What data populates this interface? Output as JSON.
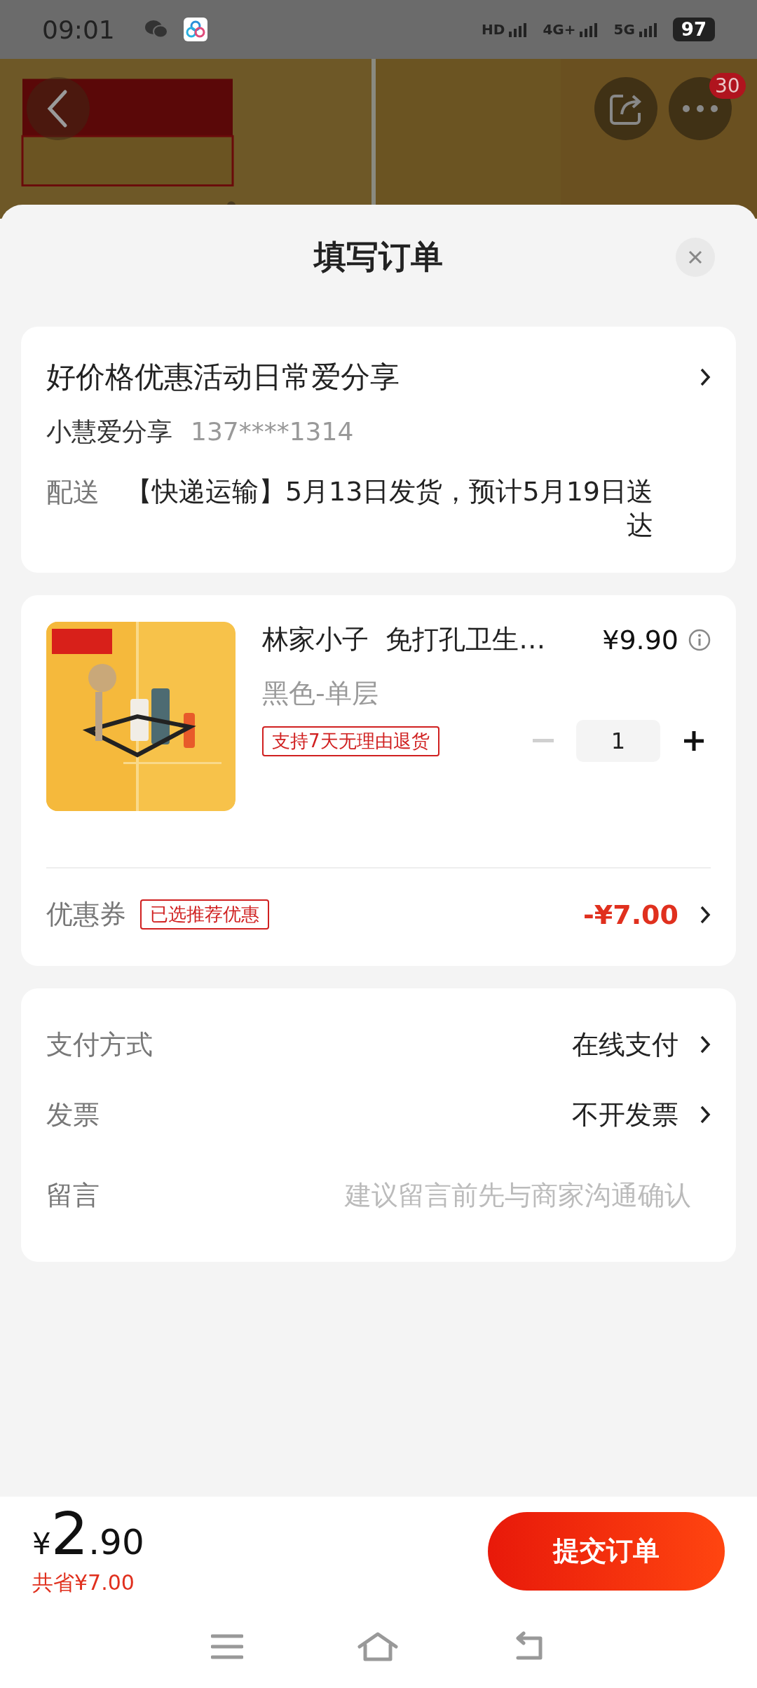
{
  "status_bar": {
    "time": "09:01",
    "network_labels": [
      "HD",
      "4G+",
      "5G"
    ],
    "battery": "97"
  },
  "header": {
    "notification_count": "30"
  },
  "sheet": {
    "title": "填写订单"
  },
  "address": {
    "title": "好价格优惠活动日常爱分享",
    "name": "小慧爱分享",
    "phone": "137****1314",
    "delivery_label": "配送",
    "delivery_text": "【快递运输】5月13日发货，预计5月19日送达"
  },
  "product": {
    "title": "林家小子  免打孔卫生…",
    "price": "¥9.90",
    "spec": "黑色-单层",
    "tag": "支持7天无理由退货",
    "quantity": "1",
    "minus_disabled": true
  },
  "coupon": {
    "label": "优惠券",
    "tag": "已选推荐优惠",
    "value": "-¥7.00"
  },
  "options": [
    {
      "kind": "select",
      "label": "支付方式",
      "value": "在线支付"
    },
    {
      "kind": "select",
      "label": "发票",
      "value": "不开发票"
    },
    {
      "kind": "input",
      "label": "留言",
      "placeholder": "建议留言前先与商家沟通确认"
    }
  ],
  "footer": {
    "currency": "¥",
    "price_integer": "2",
    "price_decimal": ".90",
    "savings": "共省¥7.00",
    "submit": "提交订单"
  }
}
